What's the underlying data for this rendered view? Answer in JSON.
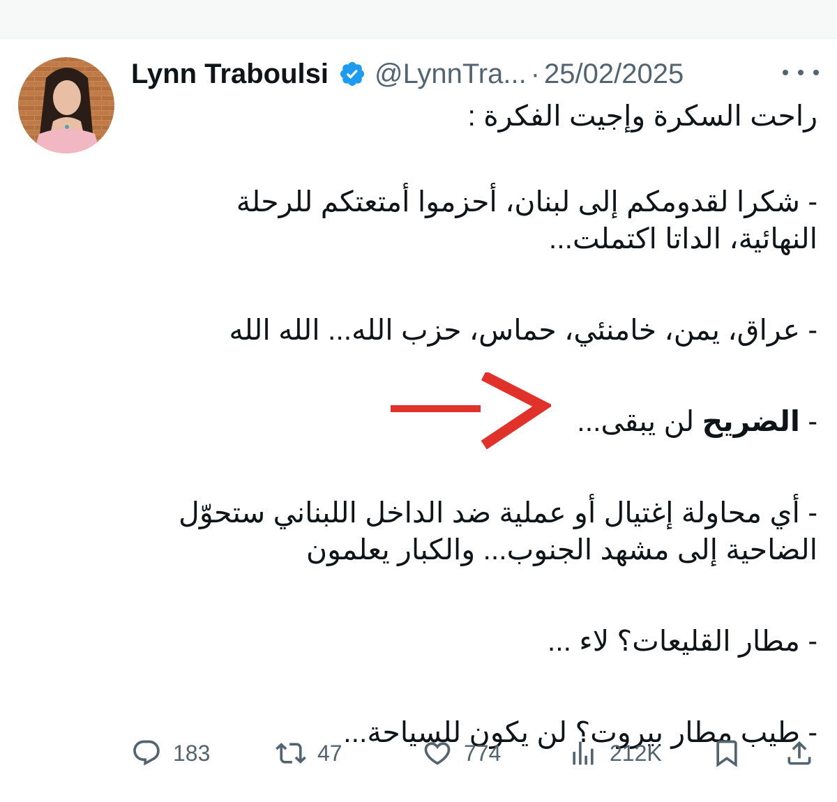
{
  "tweet": {
    "author": {
      "display_name": "Lynn Traboulsi",
      "handle": "@LynnTra...",
      "verified": true
    },
    "separator": "·",
    "date": "25/02/2025",
    "lines": {
      "l1": "راحت السكرة وإجيت الفكرة :",
      "l2": "- شكرا لقدومكم إلى لبنان، أحزموا أمتعتكم للرحلة",
      "l3": "النهائية، الداتا اكتملت...",
      "l4": "- عراق، يمن، خامنئي، حماس، حزب الله... الله الله",
      "l5_prefix": "- ",
      "l5_bold": "الضريح",
      "l5_rest": " لن يبقى...",
      "l6": "- أي محاولة إغتيال أو عملية ضد الداخل اللبناني ستحوّل",
      "l7": "الضاحية إلى مشهد الجنوب... والكبار يعلمون",
      "l8": "- مطار القليعات؟ لاء ...",
      "l9": "- طيب مطار بيروت؟ لن يكون للسياحة..."
    },
    "annotation": {
      "type": "arrow",
      "color": "#e0322b"
    },
    "actions": {
      "replies": "183",
      "reposts": "47",
      "likes": "774",
      "views": "212K"
    },
    "icons": [
      "verified-badge-icon",
      "more-options-icon",
      "reply-icon",
      "repost-icon",
      "like-icon",
      "views-icon",
      "bookmark-icon",
      "share-icon"
    ]
  },
  "colors": {
    "text_primary": "#0f1419",
    "text_secondary": "#536471",
    "verified_blue": "#1d9bf0",
    "arrow_red": "#e0322b",
    "top_bar": "#f7f9f9"
  }
}
